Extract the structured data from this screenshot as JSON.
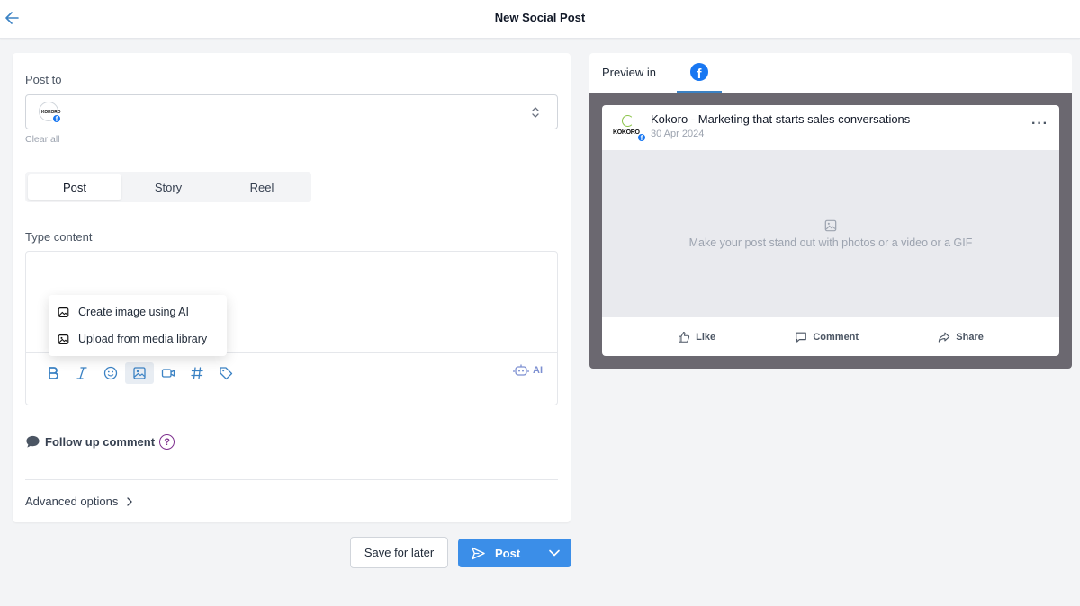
{
  "header": {
    "title": "New Social Post",
    "back_icon": "arrow-left-icon"
  },
  "composer": {
    "post_to_label": "Post to",
    "account_logo_text": "KOKORO",
    "clear_all": "Clear all",
    "types": [
      {
        "label": "Post",
        "active": true
      },
      {
        "label": "Story",
        "active": false
      },
      {
        "label": "Reel",
        "active": false
      }
    ],
    "type_content_label": "Type content",
    "toolbar": [
      "bold-icon",
      "italic-icon",
      "emoji-icon",
      "image-icon",
      "video-icon",
      "hashtag-icon",
      "tag-icon"
    ],
    "ai_label": "AI",
    "media_menu": [
      {
        "label": "Create image using AI",
        "icon": "ai-image-icon"
      },
      {
        "label": "Upload from media library",
        "icon": "image-icon"
      }
    ],
    "follow_up_label": "Follow up comment",
    "help_icon_text": "?",
    "advanced_options": "Advanced options"
  },
  "footer": {
    "save_later": "Save for later",
    "post": "Post"
  },
  "preview": {
    "label": "Preview in",
    "platform": "Facebook",
    "page_name": "Kokoro - Marketing that starts sales conversations",
    "avatar_text": "KOKORO",
    "date": "30 Apr 2024",
    "media_placeholder": "Make your post stand out with photos or a video or a GIF",
    "actions": [
      {
        "label": "Like",
        "icon": "thumbs-up-icon"
      },
      {
        "label": "Comment",
        "icon": "comment-icon"
      },
      {
        "label": "Share",
        "icon": "share-icon"
      }
    ]
  },
  "colors": {
    "accent": "#3b8ee8",
    "facebook": "#1877f2",
    "help": "#7e2f8e",
    "preview_backdrop": "#6b6870"
  }
}
